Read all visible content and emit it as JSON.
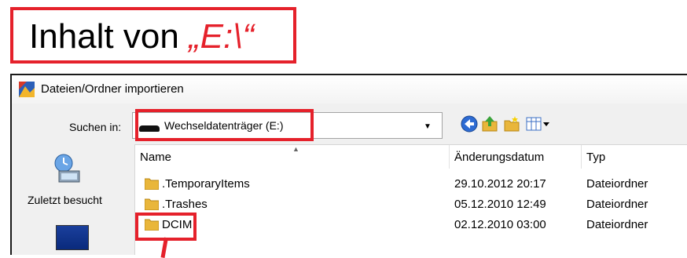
{
  "annotation": {
    "heading_prefix": "Inhalt von ",
    "heading_path": "„E:\\“"
  },
  "dialog": {
    "title": "Dateien/Ordner importieren",
    "lookin_label": "Suchen in:",
    "lookin_value": "Wechseldatenträger (E:)",
    "toolbar_icons": [
      "back-icon",
      "up-folder-icon",
      "new-folder-icon",
      "views-menu-icon"
    ]
  },
  "places": [
    {
      "label": "Zuletzt besucht",
      "icon": "recent-places-icon"
    },
    {
      "label": "",
      "icon": "desktop-icon"
    }
  ],
  "columns": {
    "name": "Name",
    "date": "Änderungsdatum",
    "type": "Typ"
  },
  "files": [
    {
      "name": ".TemporaryItems",
      "date": "29.10.2012 20:17",
      "type": "Dateiordner"
    },
    {
      "name": ".Trashes",
      "date": "05.12.2010 12:49",
      "type": "Dateiordner"
    },
    {
      "name": "DCIM",
      "date": "02.12.2010 03:00",
      "type": "Dateiordner"
    }
  ],
  "colors": {
    "highlight": "#e5212b",
    "folder": "#e9b63b"
  }
}
